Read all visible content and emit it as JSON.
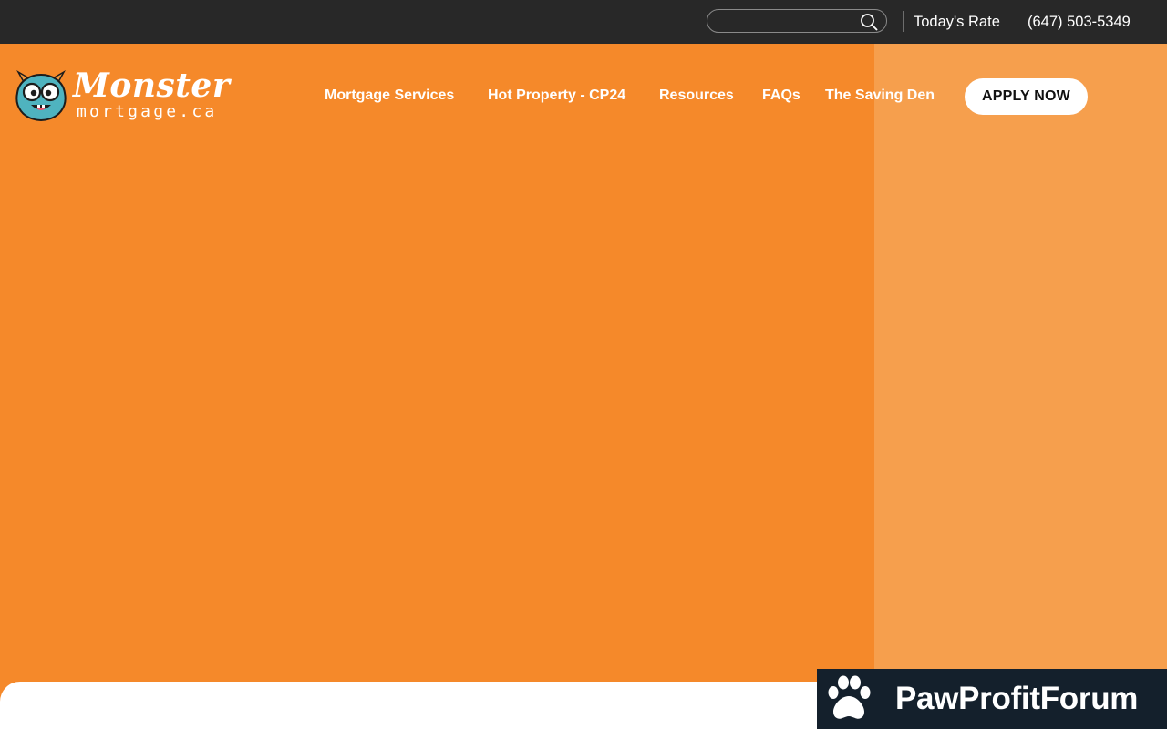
{
  "topbar": {
    "search": {
      "value": "",
      "placeholder": "",
      "icon": "search-icon"
    },
    "todays_rate_label": "Today's Rate",
    "phone": "(647) 503-5349"
  },
  "header": {
    "logo": {
      "word": "Monster",
      "sub": "mortgage.ca"
    },
    "nav": [
      {
        "label": "Mortgage Services"
      },
      {
        "label": "Hot Property - CP24"
      },
      {
        "label": "Resources"
      },
      {
        "label": "FAQs"
      },
      {
        "label": "The Saving Den"
      }
    ],
    "cta_label": "APPLY NOW"
  },
  "watermark": {
    "text": "PawProfitForum",
    "icon": "paw-icon"
  },
  "colors": {
    "topbar_bg": "#282828",
    "hero_orange": "#f5892a",
    "hero_orange_light": "#f69f4d",
    "cta_bg": "#ffffff",
    "watermark_bg": "#14202c",
    "mascot_teal": "#4fb3bf"
  }
}
